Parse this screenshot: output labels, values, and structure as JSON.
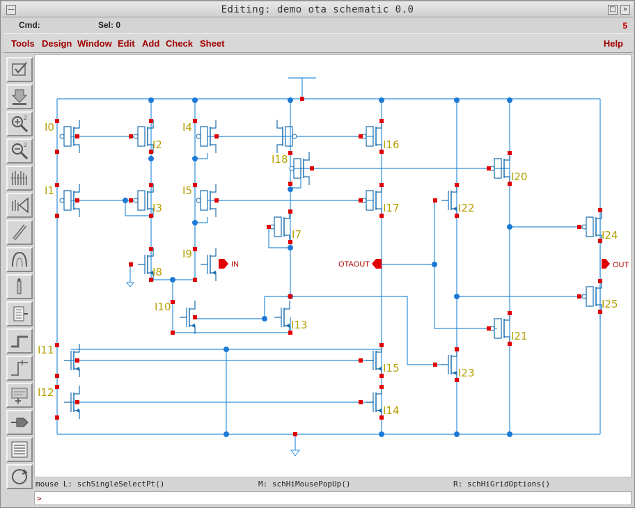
{
  "window": {
    "title": "Editing: demo ota schematic 0.0",
    "menu_glyph": "—",
    "min_glyph": "□",
    "max_glyph": "»"
  },
  "cmd_bar": {
    "cmd_label": "Cmd:",
    "sel_label": "Sel: 0",
    "count": "5"
  },
  "menubar": {
    "items": [
      "Tools",
      "Design",
      "Window",
      "Edit",
      "Add",
      "Check",
      "Sheet"
    ],
    "help": "Help"
  },
  "toolbar": {
    "buttons": [
      "check-icon",
      "save-icon",
      "zoom-in-icon",
      "zoom-out-icon",
      "stretch-icon",
      "copy-icon",
      "wire-icon",
      "arc-icon",
      "label-icon",
      "instance-icon",
      "route-icon",
      "bend-icon",
      "property-icon",
      "pin-icon",
      "netlist-icon",
      "repeat-icon"
    ]
  },
  "schematic": {
    "instances": [
      "I0",
      "I1",
      "I2",
      "I3",
      "I4",
      "I5",
      "I7",
      "I8",
      "I9",
      "I10",
      "I11",
      "I12",
      "I13",
      "I14",
      "I15",
      "I16",
      "I17",
      "I18",
      "I20",
      "I21",
      "I22",
      "I23",
      "I24",
      "I25"
    ],
    "pins": {
      "in": "IN",
      "otaout": "OTAOUT",
      "out": "OUT"
    },
    "colors": {
      "wire": "#2f8fdc",
      "device": "#1a6fb0",
      "pin": "#e00000",
      "label": "#b5a000",
      "node": "#1c7ad6"
    }
  },
  "status": {
    "mouse_left": "mouse L: schSingleSelectPt()",
    "mouse_middle": "M: schHiMousePopUp()",
    "mouse_right": "R: schHiGridOptions()"
  },
  "cmdline": {
    "prompt": ">",
    "value": ""
  }
}
